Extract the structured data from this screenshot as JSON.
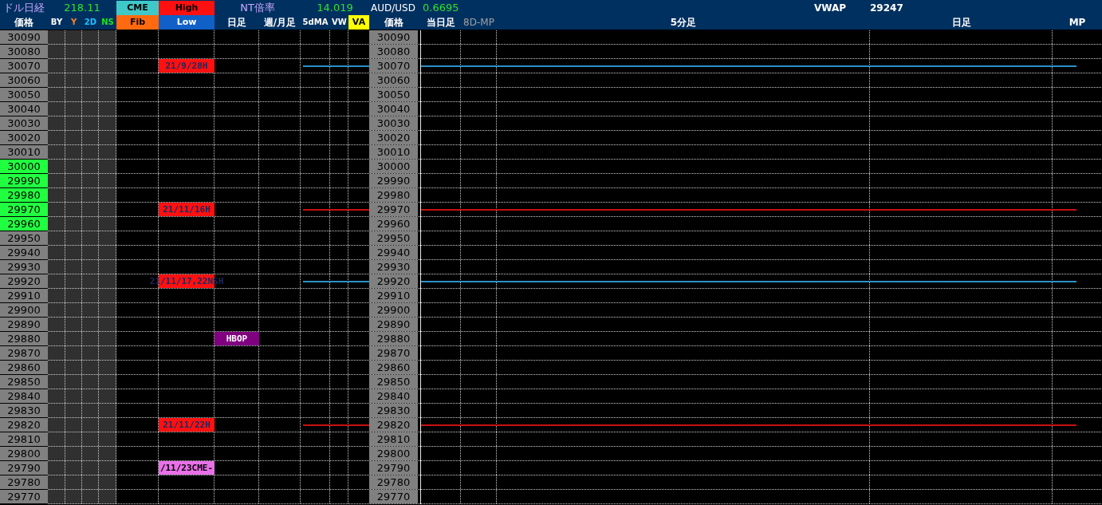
{
  "header_top": [
    {
      "text": "ドル日経",
      "kind": "label"
    },
    {
      "text": "218.11",
      "kind": "value"
    },
    {
      "text": "CME",
      "kind": "cme"
    },
    {
      "text": "High",
      "kind": "high"
    },
    {
      "text": "NT倍率",
      "kind": "label"
    },
    {
      "text": "14.019",
      "kind": "value"
    },
    {
      "text": "AUD/USD",
      "kind": "plain"
    },
    {
      "text": "0.6695",
      "kind": "value"
    },
    {
      "text": "VWAP",
      "kind": "plain"
    },
    {
      "text": "29247",
      "kind": "plain"
    }
  ],
  "columns": [
    {
      "text": "価格",
      "kind": "plain"
    },
    {
      "text": "BY",
      "kind": "plain",
      "color": "#ffffff"
    },
    {
      "text": "Y",
      "kind": "plain",
      "color": "#ff8020"
    },
    {
      "text": "2D",
      "kind": "plain",
      "color": "#20c0ff"
    },
    {
      "text": "NS",
      "kind": "plain",
      "color": "#20e020"
    },
    {
      "text": "Fib",
      "kind": "fib"
    },
    {
      "text": "Low",
      "kind": "low"
    },
    {
      "text": "日足",
      "kind": "plain"
    },
    {
      "text": "週/月足",
      "kind": "plain"
    },
    {
      "text": "5dMA",
      "kind": "plain"
    },
    {
      "text": "VW",
      "kind": "plain"
    },
    {
      "text": "VA",
      "kind": "va"
    },
    {
      "text": "価格",
      "kind": "plain"
    },
    {
      "text": "当日足",
      "kind": "plain"
    },
    {
      "text": "8D-MP",
      "kind": "muted"
    },
    {
      "text": "5分足",
      "kind": "plain"
    },
    {
      "text": "日足",
      "kind": "plain"
    },
    {
      "text": "MP",
      "kind": "plain"
    }
  ],
  "rows": [
    {
      "price": "30090",
      "highlighted": false,
      "price_2": "30090"
    },
    {
      "price": "30080",
      "highlighted": false,
      "price_2": "30080"
    },
    {
      "price": "30070",
      "highlighted": false,
      "price_2": "30070",
      "tag": {
        "text": "21/9/28H",
        "kind": "high"
      },
      "line": {
        "color": "#2a90c8"
      }
    },
    {
      "price": "30060",
      "highlighted": false,
      "price_2": "30060"
    },
    {
      "price": "30050",
      "highlighted": false,
      "price_2": "30050"
    },
    {
      "price": "30040",
      "highlighted": false,
      "price_2": "30040"
    },
    {
      "price": "30030",
      "highlighted": false,
      "price_2": "30030"
    },
    {
      "price": "30020",
      "highlighted": false,
      "price_2": "30020"
    },
    {
      "price": "30010",
      "highlighted": false,
      "price_2": "30010"
    },
    {
      "price": "30000",
      "highlighted": true,
      "price_2": "30000"
    },
    {
      "price": "29990",
      "highlighted": true,
      "price_2": "29990"
    },
    {
      "price": "29980",
      "highlighted": true,
      "price_2": "29980"
    },
    {
      "price": "29970",
      "highlighted": true,
      "price_2": "29970",
      "tag": {
        "text": "21/11/16H",
        "kind": "high"
      },
      "line": {
        "color": "#c81010"
      }
    },
    {
      "price": "29960",
      "highlighted": true,
      "price_2": "29960"
    },
    {
      "price": "29950",
      "highlighted": false,
      "price_2": "29950"
    },
    {
      "price": "29940",
      "highlighted": false,
      "price_2": "29940"
    },
    {
      "price": "29930",
      "highlighted": false,
      "price_2": "29930"
    },
    {
      "price": "29920",
      "highlighted": false,
      "price_2": "29920",
      "tag": {
        "text": "21/11/17,22NSH",
        "kind": "high"
      },
      "line": {
        "color": "#2a90c8"
      }
    },
    {
      "price": "29910",
      "highlighted": false,
      "price_2": "29910"
    },
    {
      "price": "29900",
      "highlighted": false,
      "price_2": "29900"
    },
    {
      "price": "29890",
      "highlighted": false,
      "price_2": "29890"
    },
    {
      "price": "29880",
      "highlighted": false,
      "price_2": "29880",
      "tag": {
        "text": "HBOP",
        "kind": "pivot"
      }
    },
    {
      "price": "29870",
      "highlighted": false,
      "price_2": "29870"
    },
    {
      "price": "29860",
      "highlighted": false,
      "price_2": "29860"
    },
    {
      "price": "29850",
      "highlighted": false,
      "price_2": "29850"
    },
    {
      "price": "29840",
      "highlighted": false,
      "price_2": "29840"
    },
    {
      "price": "29830",
      "highlighted": false,
      "price_2": "29830"
    },
    {
      "price": "29820",
      "highlighted": false,
      "price_2": "29820",
      "tag": {
        "text": "21/11/22H",
        "kind": "high"
      },
      "line": {
        "color": "#c81010"
      }
    },
    {
      "price": "29810",
      "highlighted": false,
      "price_2": "29810"
    },
    {
      "price": "29800",
      "highlighted": false,
      "price_2": "29800"
    },
    {
      "price": "29790",
      "highlighted": false,
      "price_2": "29790",
      "tag": {
        "text": "/11/23CME-",
        "kind": "cme"
      }
    },
    {
      "price": "29780",
      "highlighted": false,
      "price_2": "29780"
    },
    {
      "price": "29770",
      "highlighted": false,
      "price_2": "29770"
    }
  ]
}
